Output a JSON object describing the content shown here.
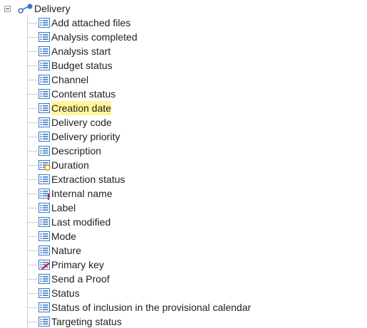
{
  "tree": {
    "root": {
      "label": "Delivery",
      "icon": "link-icon",
      "expanded": true
    },
    "items": [
      {
        "label": "Add attached files",
        "icon": "field-list-icon"
      },
      {
        "label": "Analysis completed",
        "icon": "field-list-icon"
      },
      {
        "label": "Analysis start",
        "icon": "field-list-icon"
      },
      {
        "label": "Budget status",
        "icon": "field-list-icon"
      },
      {
        "label": "Channel",
        "icon": "field-list-icon"
      },
      {
        "label": "Content status",
        "icon": "field-list-icon"
      },
      {
        "label": "Creation date",
        "icon": "field-list-icon",
        "highlighted": true
      },
      {
        "label": "Delivery code",
        "icon": "field-list-icon"
      },
      {
        "label": "Delivery priority",
        "icon": "field-list-icon"
      },
      {
        "label": "Description",
        "icon": "field-list-icon"
      },
      {
        "label": "Duration",
        "icon": "calculated-field-icon"
      },
      {
        "label": "Extraction status",
        "icon": "field-list-icon"
      },
      {
        "label": "Internal name",
        "icon": "mandatory-field-icon"
      },
      {
        "label": "Label",
        "icon": "field-list-icon"
      },
      {
        "label": "Last modified",
        "icon": "field-list-icon"
      },
      {
        "label": "Mode",
        "icon": "field-list-icon"
      },
      {
        "label": "Nature",
        "icon": "field-list-icon"
      },
      {
        "label": "Primary key",
        "icon": "primary-key-icon"
      },
      {
        "label": "Send a Proof",
        "icon": "field-list-icon"
      },
      {
        "label": "Status",
        "icon": "field-list-icon"
      },
      {
        "label": "Status of inclusion in the provisional calendar",
        "icon": "field-list-icon"
      },
      {
        "label": "Targeting status",
        "icon": "field-list-icon"
      }
    ]
  },
  "colors": {
    "highlight": "#fff59a",
    "icon_blue": "#3a78c4",
    "mandatory_red": "#d0202a",
    "calculated_orange": "#e09a1a",
    "key_red": "#d0202a"
  }
}
